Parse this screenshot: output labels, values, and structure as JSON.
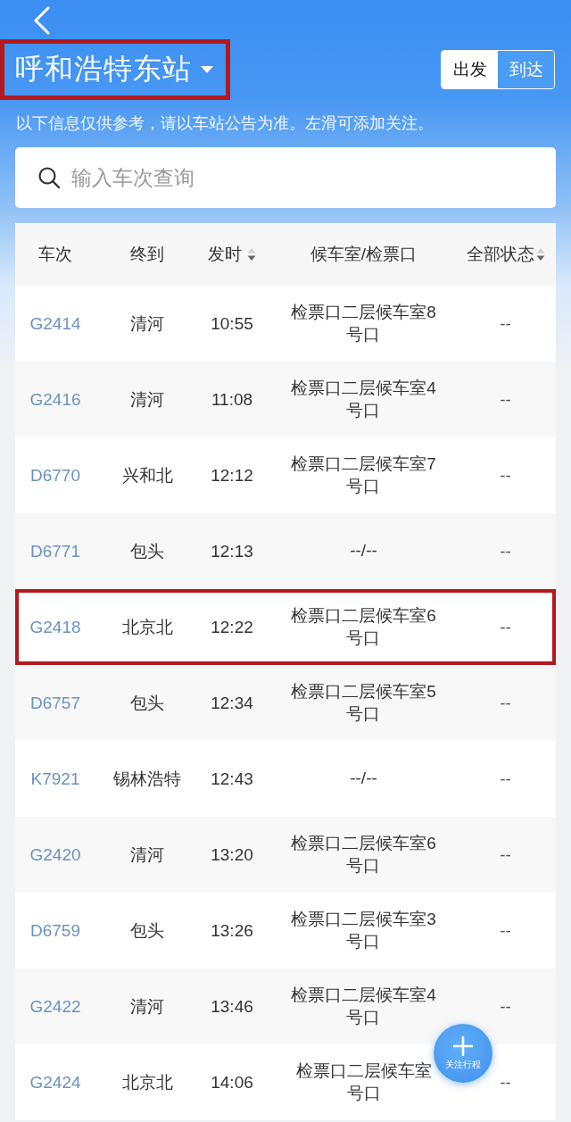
{
  "header": {
    "station": "呼和浩特东站",
    "highlighted": true,
    "mode_tabs": [
      {
        "label": "出发",
        "selected": true
      },
      {
        "label": "到达",
        "selected": false
      }
    ]
  },
  "notice": "以下信息仅供参考，请以车站公告为准。左滑可添加关注。",
  "search": {
    "placeholder": "输入车次查询"
  },
  "table": {
    "columns": [
      {
        "label": "车次",
        "sortable": false
      },
      {
        "label": "终到",
        "sortable": false
      },
      {
        "label": "发时",
        "sortable": true
      },
      {
        "label": "候车室/检票口",
        "sortable": false
      },
      {
        "label": "全部状态",
        "sortable": true
      }
    ],
    "rows": [
      {
        "train": "G2414",
        "destination": "清河",
        "departs": "10:55",
        "gate": [
          "检票口二层候车室8",
          "号口"
        ],
        "status": "--",
        "highlighted": false
      },
      {
        "train": "G2416",
        "destination": "清河",
        "departs": "11:08",
        "gate": [
          "检票口二层候车室4",
          "号口"
        ],
        "status": "--",
        "highlighted": false
      },
      {
        "train": "D6770",
        "destination": "兴和北",
        "departs": "12:12",
        "gate": [
          "检票口二层候车室7",
          "号口"
        ],
        "status": "--",
        "highlighted": false
      },
      {
        "train": "D6771",
        "destination": "包头",
        "departs": "12:13",
        "gate": [
          "--/--"
        ],
        "status": "--",
        "highlighted": false
      },
      {
        "train": "G2418",
        "destination": "北京北",
        "departs": "12:22",
        "gate": [
          "检票口二层候车室6",
          "号口"
        ],
        "status": "--",
        "highlighted": true
      },
      {
        "train": "D6757",
        "destination": "包头",
        "departs": "12:34",
        "gate": [
          "检票口二层候车室5",
          "号口"
        ],
        "status": "--",
        "highlighted": false
      },
      {
        "train": "K7921",
        "destination": "锡林浩特",
        "departs": "12:43",
        "gate": [
          "--/--"
        ],
        "status": "--",
        "highlighted": false
      },
      {
        "train": "G2420",
        "destination": "清河",
        "departs": "13:20",
        "gate": [
          "检票口二层候车室6",
          "号口"
        ],
        "status": "--",
        "highlighted": false
      },
      {
        "train": "D6759",
        "destination": "包头",
        "departs": "13:26",
        "gate": [
          "检票口二层候车室3",
          "号口"
        ],
        "status": "--",
        "highlighted": false
      },
      {
        "train": "G2422",
        "destination": "清河",
        "departs": "13:46",
        "gate": [
          "检票口二层候车室4",
          "号口"
        ],
        "status": "--",
        "highlighted": false
      },
      {
        "train": "G2424",
        "destination": "北京北",
        "departs": "14:06",
        "gate": [
          "检票口二层候车室",
          "号口"
        ],
        "status": "--",
        "highlighted": false
      }
    ]
  },
  "fab": {
    "label": "关注行程"
  }
}
